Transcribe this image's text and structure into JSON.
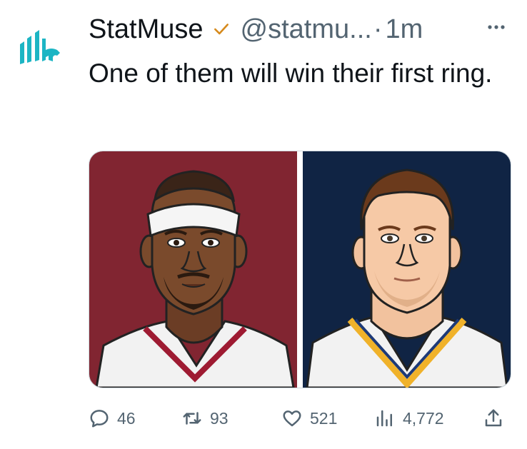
{
  "author": {
    "name": "StatMuse",
    "handle": "@statmu...",
    "separator": "·",
    "time": "1m",
    "avatar_icon": "statmuse-logo",
    "verified_icon": "verified-check-icon"
  },
  "tweet": {
    "text": "One of them will win their first ring."
  },
  "media": {
    "left_color": "#812531",
    "right_color": "#102444"
  },
  "actions": {
    "replies": "46",
    "retweets": "93",
    "likes": "521",
    "views": "4,772"
  },
  "colors": {
    "accent_logo": "#1cb5c4",
    "verified": "#d68a1c",
    "muted": "#536471"
  }
}
